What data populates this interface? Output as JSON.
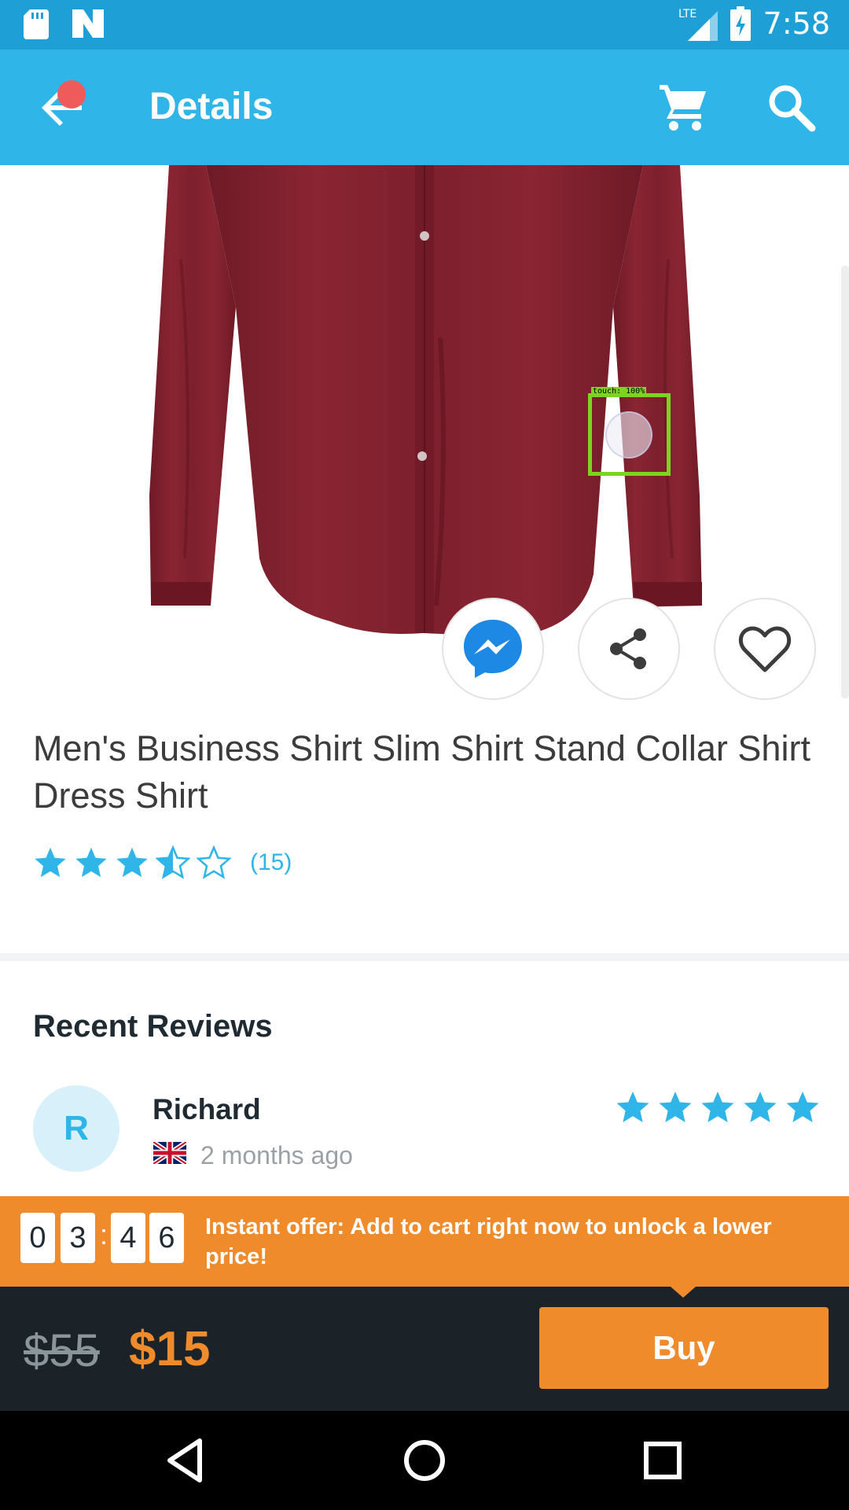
{
  "status_bar": {
    "time": "7:58",
    "network": "LTE",
    "icons": [
      "sd-card-icon",
      "n-app-icon",
      "signal-icon",
      "battery-charging-icon"
    ]
  },
  "app_bar": {
    "title": "Details",
    "icons": [
      "back-arrow-icon",
      "cart-icon",
      "search-icon"
    ],
    "accent": "#2fb5e8"
  },
  "touch_overlay": {
    "label": "touch: 100%"
  },
  "actions": {
    "icons": [
      "messenger-icon",
      "share-icon",
      "heart-icon"
    ]
  },
  "product": {
    "title": "Men's Business Shirt Slim Shirt Stand Collar Shirt Dress Shirt",
    "rating": 3.5,
    "rating_max": 5,
    "review_count": "(15)"
  },
  "reviews": {
    "heading": "Recent Reviews",
    "items": [
      {
        "initial": "R",
        "name": "Richard",
        "country_flag": "uk-flag-icon",
        "time": "2 months ago",
        "rating": 5
      }
    ]
  },
  "offer": {
    "timer_digits": [
      "0",
      "3",
      "4",
      "6"
    ],
    "separator": ":",
    "text": "Instant offer: Add to cart right now to unlock a lower price!",
    "color": "#f08b2c"
  },
  "purchase": {
    "old_price": "$55",
    "price": "$15",
    "buy_label": "Buy"
  },
  "nav_bar": {
    "icons": [
      "back-triangle-icon",
      "home-circle-icon",
      "recents-square-icon"
    ]
  }
}
